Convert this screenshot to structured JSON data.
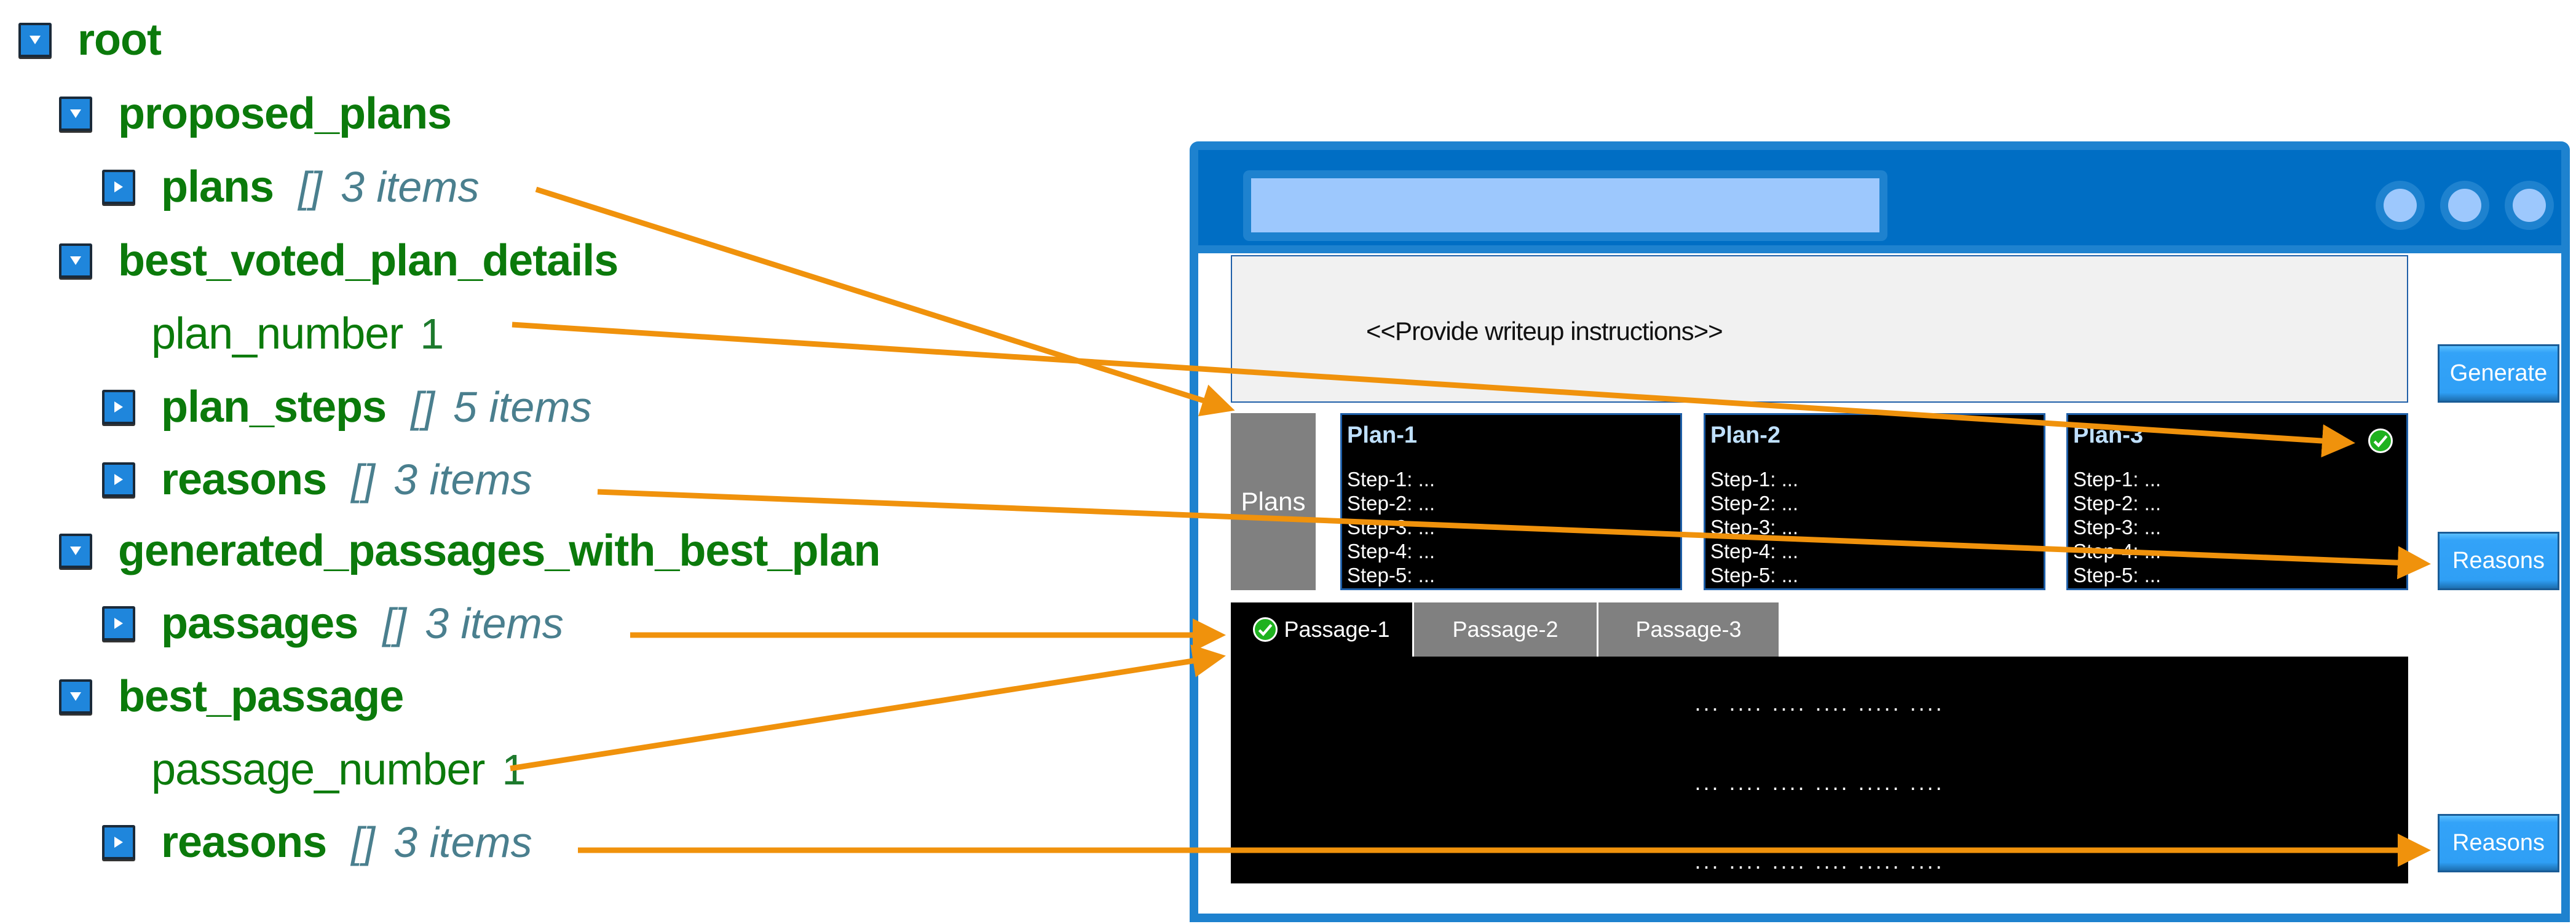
{
  "tree": {
    "root": {
      "key": "root",
      "expanded": true
    },
    "proposed_plans": {
      "key": "proposed_plans",
      "expanded": true
    },
    "plans": {
      "key": "plans",
      "type_glyph": "[]",
      "count_label": "3 items",
      "expanded": false
    },
    "best_voted_plan_details": {
      "key": "best_voted_plan_details",
      "expanded": true
    },
    "plan_number": {
      "key": "plan_number",
      "value": "1"
    },
    "plan_steps": {
      "key": "plan_steps",
      "type_glyph": "[]",
      "count_label": "5 items",
      "expanded": false
    },
    "plan_reasons": {
      "key": "reasons",
      "type_glyph": "[]",
      "count_label": "3 items",
      "expanded": false
    },
    "generated_passages_with_best_plan": {
      "key": "generated_passages_with_best_plan",
      "expanded": true
    },
    "passages": {
      "key": "passages",
      "type_glyph": "[]",
      "count_label": "3 items",
      "expanded": false
    },
    "best_passage": {
      "key": "best_passage",
      "expanded": true
    },
    "passage_number": {
      "key": "passage_number",
      "value": "1"
    },
    "passage_reasons": {
      "key": "reasons",
      "type_glyph": "[]",
      "count_label": "3 items",
      "expanded": false
    }
  },
  "window": {
    "instructions_placeholder": "<<Provide writeup instructions>>",
    "generate_label": "Generate",
    "plans_label": "Plans",
    "plans": [
      {
        "title": "Plan-1",
        "steps": [
          "Step-1: ...",
          "Step-2: ...",
          "Step-3: ...",
          "Step-4: ...",
          "Step-5: ..."
        ],
        "selected": false
      },
      {
        "title": "Plan-2",
        "steps": [
          "Step-1: ...",
          "Step-2: ...",
          "Step-3: ...",
          "Step-4: ...",
          "Step-5: ..."
        ],
        "selected": false
      },
      {
        "title": "Plan-3",
        "steps": [
          "Step-1: ...",
          "Step-2: ...",
          "Step-3: ...",
          "Step-4: ...",
          "Step-5: ..."
        ],
        "selected": true
      }
    ],
    "plan_reasons_label": "Reasons",
    "passage_tabs": [
      {
        "label": "Passage-1",
        "active": true,
        "selected": true
      },
      {
        "label": "Passage-2",
        "active": false,
        "selected": false
      },
      {
        "label": "Passage-3",
        "active": false,
        "selected": false
      }
    ],
    "passage_lines": [
      "...  ....  ....  ....  .....  ....",
      "...  ....  ....  ....  .....  ....",
      "...  ....  ....  ....  .....  ...."
    ],
    "passage_reasons_label": "Reasons"
  },
  "colors": {
    "tree_key": "#0b7a0b",
    "tree_meta": "#4a7f8e",
    "toggle": "#1f86dc",
    "window_frame": "#1e82cf",
    "titlebar": "#006ec4",
    "accent_light": "#9dc8fd",
    "button": "#2f9ff5",
    "arrow": "#f0920c",
    "check": "#1fb21f"
  }
}
